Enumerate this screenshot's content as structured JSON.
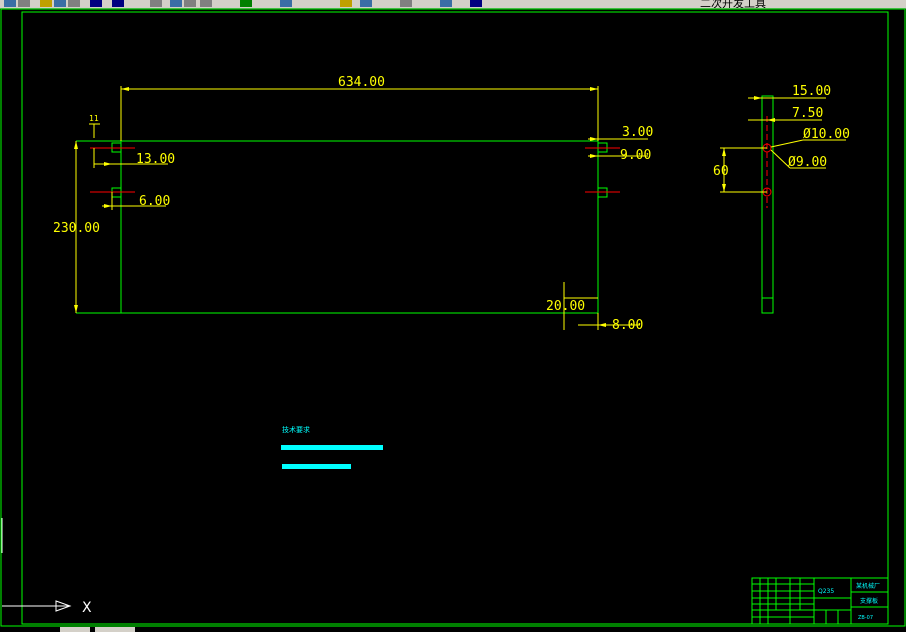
{
  "toolbar": {
    "items": [
      {
        "icon": "grid-icon"
      },
      {
        "icon": "cut-icon"
      },
      {
        "icon": "copy-icon"
      },
      {
        "icon": "paste-icon"
      },
      {
        "icon": "match-properties-icon"
      },
      {
        "icon": "undo-icon"
      },
      {
        "icon": "redo-icon"
      },
      {
        "icon": "pan-icon"
      },
      {
        "icon": "zoom-realtime-icon"
      },
      {
        "icon": "zoom-window-icon"
      },
      {
        "icon": "zoom-previous-icon"
      },
      {
        "icon": "properties-icon"
      },
      {
        "icon": "design-center-icon"
      },
      {
        "icon": "tool-palette-icon"
      },
      {
        "icon": "sheet-set-icon"
      },
      {
        "icon": "markup-icon"
      },
      {
        "icon": "quickcalc-icon"
      },
      {
        "icon": "help-icon"
      }
    ],
    "partial_text": "二次开发工具"
  },
  "drawing": {
    "front_view": {
      "dim_width": "634.00",
      "dim_height": "230.00",
      "dim_small_top": "11",
      "dim_hole_offset_x": "13.00",
      "dim_hole_offset_y": "6.00",
      "dim_right_edge": "3.00",
      "dim_right_hole": "9.00",
      "dim_bottom_height": "20.00",
      "dim_bottom_width": "8.00"
    },
    "side_view": {
      "dim_thickness": "15.00",
      "dim_half": "7.50",
      "dim_hole_large": "Ø10.00",
      "dim_hole_small": "Ø9.00",
      "dim_hole_spacing": "60"
    },
    "notes": {
      "title": "技术要求"
    },
    "title_block": {
      "part_name": "支撑板",
      "material": "Q235",
      "company": "某机械厂",
      "drawing_no": "ZB-07",
      "cells": [
        "标记",
        "处数",
        "分区",
        "更改文件号",
        "签名",
        "日期",
        "设计",
        "审核",
        "工艺",
        "批准",
        "阶段标记",
        "重量",
        "比例",
        "共",
        "张",
        "第"
      ]
    },
    "ucs": {
      "x_label": "X"
    }
  },
  "bottom_tabs": [
    "模型",
    "布局1",
    "布局2"
  ],
  "colors": {
    "background": "#000000",
    "frame": "#00ff00",
    "part_outline": "#00ff00",
    "dimension": "#ffff00",
    "centerline": "#ff0000",
    "notes": "#00ffff",
    "ucs": "#ffffff",
    "toolbar": "#d4d0c8"
  }
}
